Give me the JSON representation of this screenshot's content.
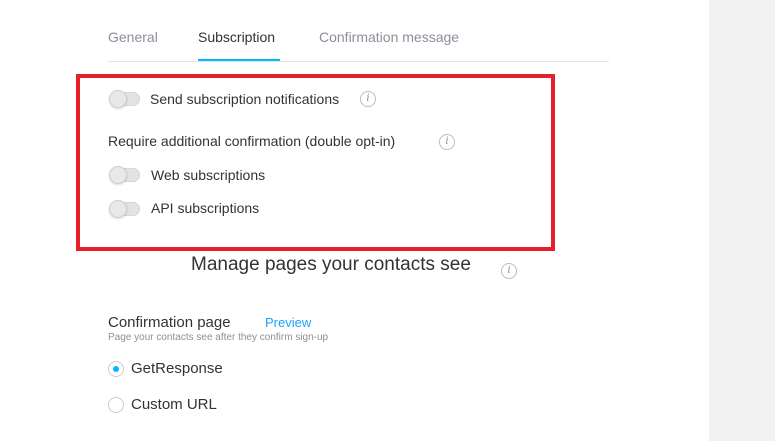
{
  "tabs": [
    {
      "label": "General",
      "active": false
    },
    {
      "label": "Subscription",
      "active": true
    },
    {
      "label": "Confirmation message",
      "active": false
    }
  ],
  "notifications": {
    "send_label": "Send subscription notifications",
    "send_on": false
  },
  "double_optin": {
    "heading": "Require additional confirmation (double opt-in)",
    "web_label": "Web subscriptions",
    "web_on": false,
    "api_label": "API subscriptions",
    "api_on": false
  },
  "pages_section": {
    "title": "Manage pages your contacts see",
    "confirmation_page": {
      "label": "Confirmation page",
      "preview_link": "Preview",
      "hint": "Page your contacts see after they confirm sign-up",
      "options": [
        {
          "label": "GetResponse",
          "selected": true
        },
        {
          "label": "Custom URL",
          "selected": false
        }
      ]
    }
  },
  "icons": {
    "info_glyph": "i"
  },
  "colors": {
    "accent": "#00baff",
    "link": "#1aa3ff",
    "highlight_border": "#e5202c"
  }
}
